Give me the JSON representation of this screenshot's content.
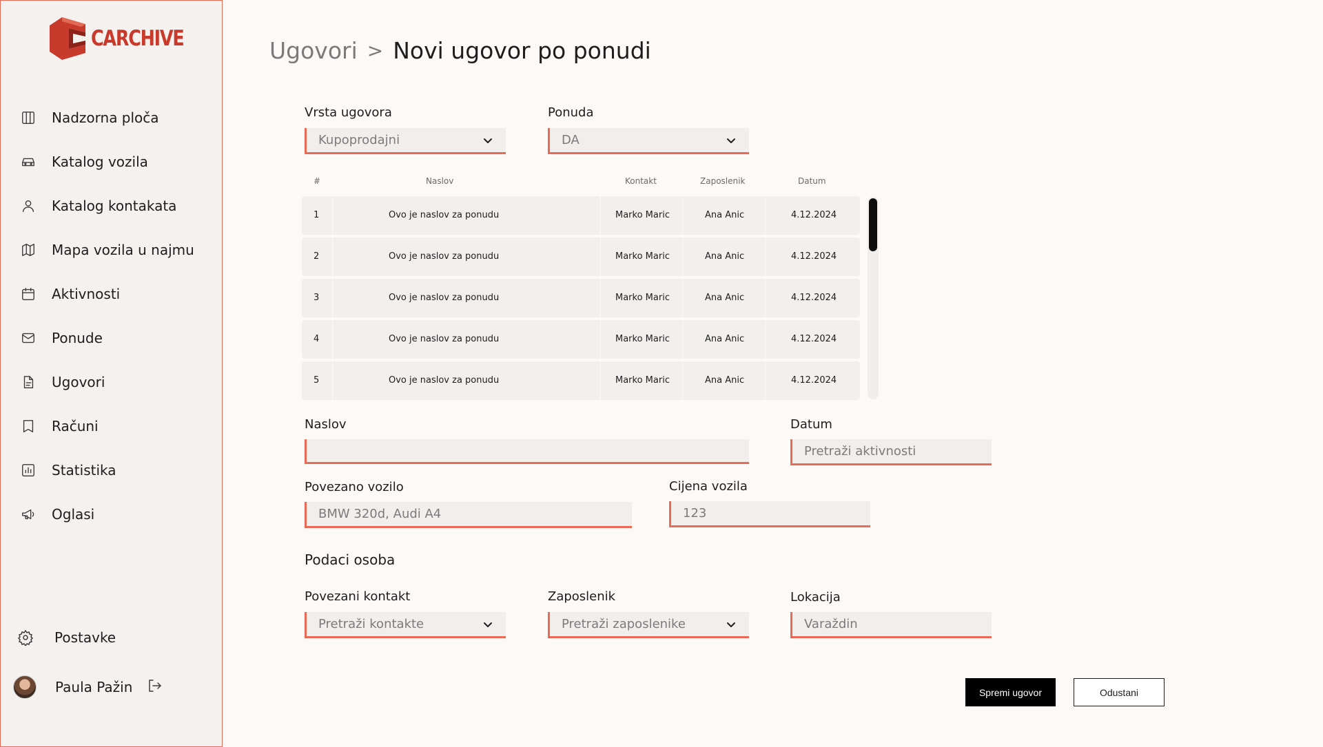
{
  "app": {
    "logo_text": "CARCHIVE"
  },
  "sidebar": {
    "items": [
      {
        "label": "Nadzorna ploča",
        "icon": "dashboard-icon"
      },
      {
        "label": "Katalog vozila",
        "icon": "car-icon"
      },
      {
        "label": "Katalog kontakata",
        "icon": "user-icon"
      },
      {
        "label": "Mapa vozila u najmu",
        "icon": "map-icon"
      },
      {
        "label": "Aktivnosti",
        "icon": "calendar-icon"
      },
      {
        "label": "Ponude",
        "icon": "mail-icon"
      },
      {
        "label": "Ugovori",
        "icon": "document-icon"
      },
      {
        "label": "Računi",
        "icon": "receipt-icon"
      },
      {
        "label": "Statistika",
        "icon": "chart-icon"
      },
      {
        "label": "Oglasi",
        "icon": "megaphone-icon"
      }
    ],
    "settings_label": "Postavke",
    "user_name": "Paula Pažin"
  },
  "breadcrumb": {
    "parent": "Ugovori",
    "separator": ">",
    "current": "Novi ugovor po ponudi"
  },
  "form": {
    "contract_type": {
      "label": "Vrsta ugovora",
      "value": "Kupoprodajni"
    },
    "offer": {
      "label": "Ponuda",
      "value": "DA"
    },
    "title": {
      "label": "Naslov",
      "value": ""
    },
    "date": {
      "label": "Datum",
      "placeholder": "Pretraži aktivnosti"
    },
    "vehicle": {
      "label": "Povezano vozilo",
      "placeholder": "BMW 320d, Audi A4"
    },
    "price": {
      "label": "Cijena vozila",
      "placeholder": "123"
    },
    "section_title": "Podaci osoba",
    "contact": {
      "label": "Povezani kontakt",
      "placeholder": "Pretraži kontakte"
    },
    "employee": {
      "label": "Zaposlenik",
      "placeholder": "Pretraži zaposlenike"
    },
    "location": {
      "label": "Lokacija",
      "placeholder": "Varaždin"
    }
  },
  "table": {
    "columns": [
      "#",
      "Naslov",
      "Kontakt",
      "Zaposlenik",
      "Datum"
    ],
    "rows": [
      [
        "1",
        "Ovo je naslov za ponudu",
        "Marko Maric",
        "Ana Anic",
        "4.12.2024"
      ],
      [
        "2",
        "Ovo je naslov za ponudu",
        "Marko Maric",
        "Ana Anic",
        "4.12.2024"
      ],
      [
        "3",
        "Ovo je naslov za ponudu",
        "Marko Maric",
        "Ana Anic",
        "4.12.2024"
      ],
      [
        "4",
        "Ovo je naslov za ponudu",
        "Marko Maric",
        "Ana Anic",
        "4.12.2024"
      ],
      [
        "5",
        "Ovo je naslov za ponudu",
        "Marko Maric",
        "Ana Anic",
        "4.12.2024"
      ]
    ]
  },
  "actions": {
    "save_label": "Spremi ugovor",
    "cancel_label": "Odustani"
  },
  "colors": {
    "accent": "#e66a56",
    "brand": "#c73a2c",
    "primary_button": "#000000"
  }
}
